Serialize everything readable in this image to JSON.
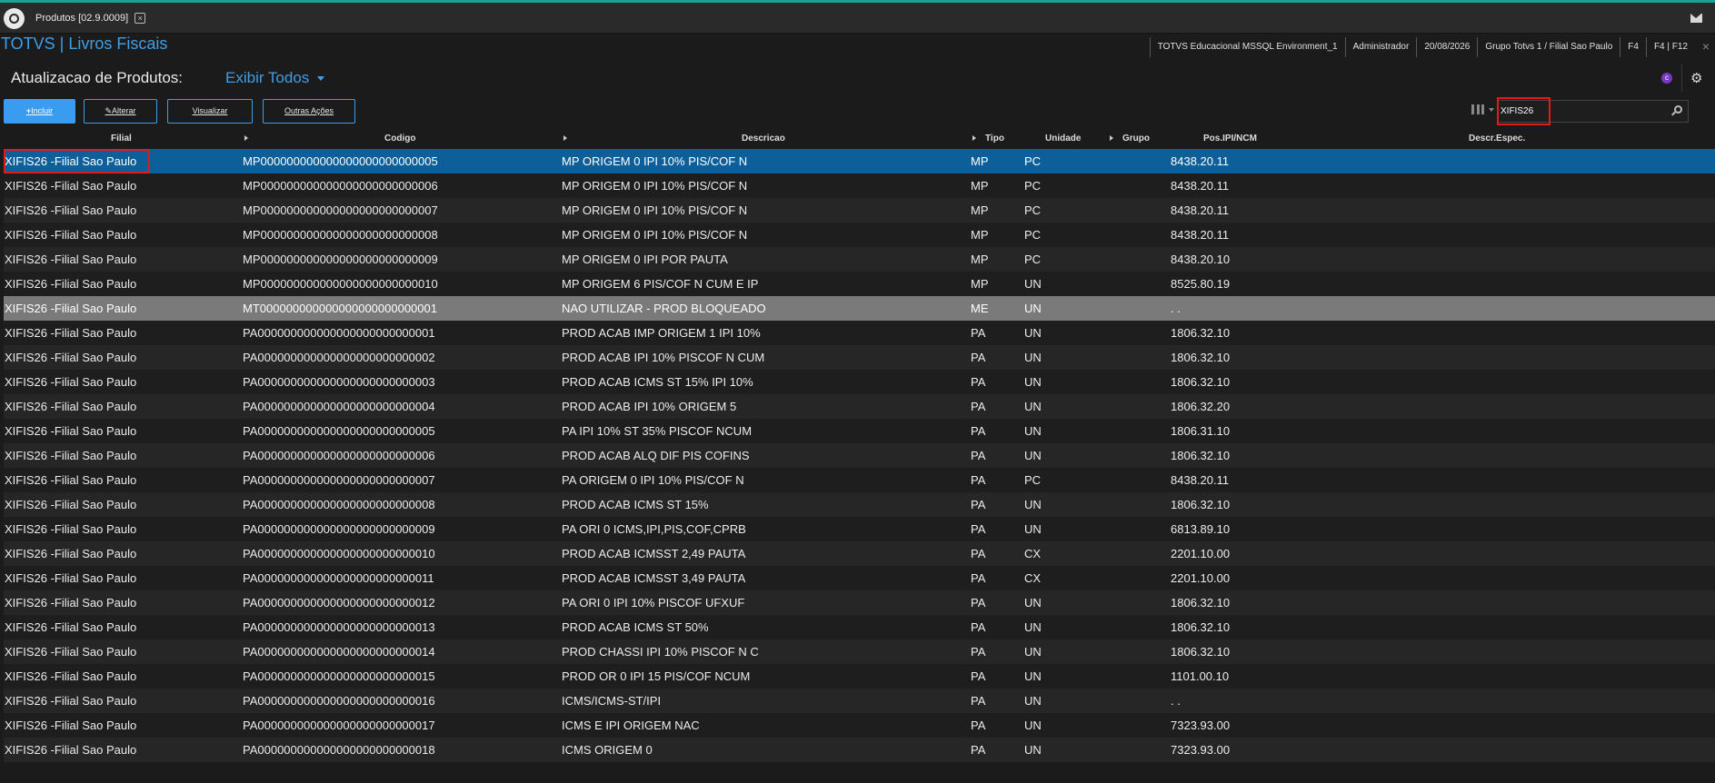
{
  "window": {
    "tab_title": "Produtos [02.9.0009]",
    "tab_close_glyph": "×"
  },
  "header": {
    "app_title": "TOTVS | Livros Fiscais",
    "environment": [
      "TOTVS Educacional MSSQL Environment_1",
      "Administrador",
      "20/08/2026",
      "Grupo Totvs 1 / Filial Sao Paulo",
      "F4",
      "F4 | F12"
    ],
    "close_glyph": "×"
  },
  "page": {
    "title": "Atualizacao de Produtos:",
    "view_filter": "Exibir Todos"
  },
  "toolbar": {
    "incluir": "Incluir",
    "alterar": "Alterar",
    "visualizar": "Visualizar",
    "outras_acoes": "Outras Ações"
  },
  "search": {
    "value": "XIFIS26",
    "placeholder": ""
  },
  "table": {
    "columns": [
      "Filial",
      "Codigo",
      "Descricao",
      "Tipo",
      "Unidade",
      "Grupo",
      "Pos.IPI/NCM",
      "Descr.Espec."
    ],
    "rows": [
      [
        "XIFIS26 -Filial Sao Paulo",
        "MP000000000000000000000000005",
        "MP ORIGEM 0 IPI 10% PIS/COF N",
        "MP",
        "PC",
        "",
        "8438.20.11",
        ""
      ],
      [
        "XIFIS26 -Filial Sao Paulo",
        "MP000000000000000000000000006",
        "MP ORIGEM 0 IPI 10% PIS/COF N",
        "MP",
        "PC",
        "",
        "8438.20.11",
        ""
      ],
      [
        "XIFIS26 -Filial Sao Paulo",
        "MP000000000000000000000000007",
        "MP ORIGEM 0 IPI 10% PIS/COF N",
        "MP",
        "PC",
        "",
        "8438.20.11",
        ""
      ],
      [
        "XIFIS26 -Filial Sao Paulo",
        "MP000000000000000000000000008",
        "MP ORIGEM 0 IPI 10% PIS/COF N",
        "MP",
        "PC",
        "",
        "8438.20.11",
        ""
      ],
      [
        "XIFIS26 -Filial Sao Paulo",
        "MP000000000000000000000000009",
        "MP ORIGEM 0 IPI POR PAUTA",
        "MP",
        "PC",
        "",
        "8438.20.10",
        ""
      ],
      [
        "XIFIS26 -Filial Sao Paulo",
        "MP000000000000000000000000010",
        "MP ORIGEM 6 PIS/COF N CUM E IP",
        "MP",
        "UN",
        "",
        "8525.80.19",
        ""
      ],
      [
        "XIFIS26 -Filial Sao Paulo",
        "MT000000000000000000000000001",
        "NAO UTILIZAR - PROD BLOQUEADO",
        "ME",
        "UN",
        "",
        ". .",
        ""
      ],
      [
        "XIFIS26 -Filial Sao Paulo",
        "PA000000000000000000000000001",
        "PROD ACAB IMP ORIGEM 1 IPI 10%",
        "PA",
        "UN",
        "",
        "1806.32.10",
        ""
      ],
      [
        "XIFIS26 -Filial Sao Paulo",
        "PA000000000000000000000000002",
        "PROD ACAB IPI 10% PISCOF N CUM",
        "PA",
        "UN",
        "",
        "1806.32.10",
        ""
      ],
      [
        "XIFIS26 -Filial Sao Paulo",
        "PA000000000000000000000000003",
        "PROD ACAB ICMS ST 15% IPI 10%",
        "PA",
        "UN",
        "",
        "1806.32.10",
        ""
      ],
      [
        "XIFIS26 -Filial Sao Paulo",
        "PA000000000000000000000000004",
        "PROD ACAB IPI 10% ORIGEM 5",
        "PA",
        "UN",
        "",
        "1806.32.20",
        ""
      ],
      [
        "XIFIS26 -Filial Sao Paulo",
        "PA000000000000000000000000005",
        "PA IPI 10% ST 35% PISCOF NCUM",
        "PA",
        "UN",
        "",
        "1806.31.10",
        ""
      ],
      [
        "XIFIS26 -Filial Sao Paulo",
        "PA000000000000000000000000006",
        "PROD ACAB ALQ DIF PIS COFINS",
        "PA",
        "UN",
        "",
        "1806.32.10",
        ""
      ],
      [
        "XIFIS26 -Filial Sao Paulo",
        "PA000000000000000000000000007",
        "PA ORIGEM 0 IPI 10% PIS/COF N",
        "PA",
        "PC",
        "",
        "8438.20.11",
        ""
      ],
      [
        "XIFIS26 -Filial Sao Paulo",
        "PA000000000000000000000000008",
        "PROD ACAB ICMS ST 15%",
        "PA",
        "UN",
        "",
        "1806.32.10",
        ""
      ],
      [
        "XIFIS26 -Filial Sao Paulo",
        "PA000000000000000000000000009",
        "PA ORI 0 ICMS,IPI,PIS,COF,CPRB",
        "PA",
        "UN",
        "",
        "6813.89.10",
        ""
      ],
      [
        "XIFIS26 -Filial Sao Paulo",
        "PA000000000000000000000000010",
        "PROD ACAB ICMSST 2,49 PAUTA",
        "PA",
        "CX",
        "",
        "2201.10.00",
        ""
      ],
      [
        "XIFIS26 -Filial Sao Paulo",
        "PA000000000000000000000000011",
        "PROD ACAB ICMSST 3,49 PAUTA",
        "PA",
        "CX",
        "",
        "2201.10.00",
        ""
      ],
      [
        "XIFIS26 -Filial Sao Paulo",
        "PA000000000000000000000000012",
        "PA ORI 0 IPI 10% PISCOF UFXUF",
        "PA",
        "UN",
        "",
        "1806.32.10",
        ""
      ],
      [
        "XIFIS26 -Filial Sao Paulo",
        "PA000000000000000000000000013",
        "PROD ACAB ICMS ST 50%",
        "PA",
        "UN",
        "",
        "1806.32.10",
        ""
      ],
      [
        "XIFIS26 -Filial Sao Paulo",
        "PA000000000000000000000000014",
        "PROD CHASSI IPI 10% PISCOF N C",
        "PA",
        "UN",
        "",
        "1806.32.10",
        ""
      ],
      [
        "XIFIS26 -Filial Sao Paulo",
        "PA000000000000000000000000015",
        "PROD OR 0 IPI 15 PIS/COF NCUM",
        "PA",
        "UN",
        "",
        "1101.00.10",
        ""
      ],
      [
        "XIFIS26 -Filial Sao Paulo",
        "PA000000000000000000000000016",
        "ICMS/ICMS-ST/IPI",
        "PA",
        "UN",
        "",
        ". .",
        ""
      ],
      [
        "XIFIS26 -Filial Sao Paulo",
        "PA000000000000000000000000017",
        "ICMS E IPI ORIGEM NAC",
        "PA",
        "UN",
        "",
        "7323.93.00",
        ""
      ],
      [
        "XIFIS26 -Filial Sao Paulo",
        "PA000000000000000000000000018",
        "ICMS ORIGEM 0",
        "PA",
        "UN",
        "",
        "7323.93.00",
        ""
      ]
    ],
    "selected_row": 0,
    "blocked_row": 6
  },
  "colors": {
    "accent": "#3e9fe8",
    "selected_row": "#0d5f9a",
    "blocked_row": "#7a7a7a",
    "highlight": "#e01b1b"
  },
  "icons": {
    "tab_logo": "totvs-logo-icon",
    "mail": "mail-icon",
    "settings": "gear-icon",
    "search": "search-icon",
    "columns": "grid-columns-icon"
  }
}
